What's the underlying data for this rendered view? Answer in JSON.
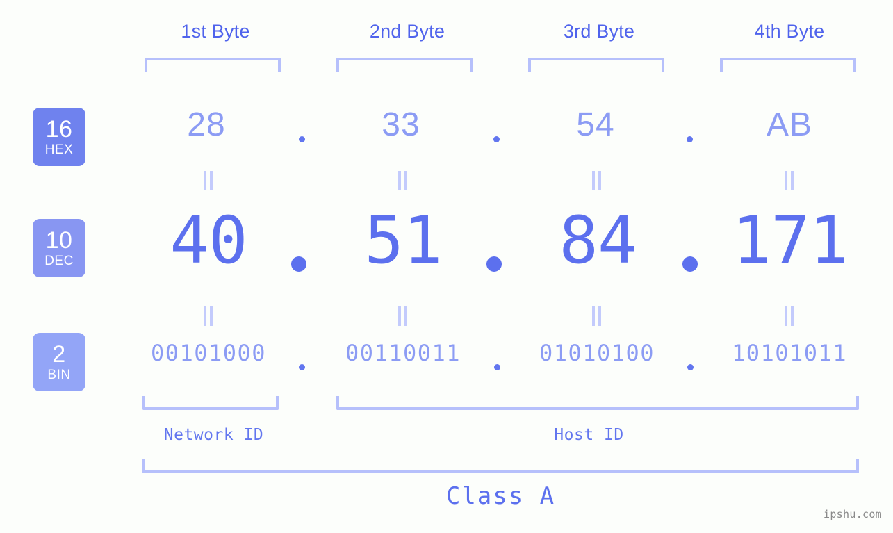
{
  "background_color": "#fcfefb",
  "accent_colors": {
    "strong_blue": "#5c70ee",
    "mid_blue": "#8c9cf4",
    "light_blue": "#b6c0fb",
    "badge_hex": "#6f82ee",
    "badge_dec": "#8896f2",
    "badge_bin": "#93a5f7",
    "watermark_gray": "#8a8a8a"
  },
  "byte_headers": [
    {
      "label": "1st Byte"
    },
    {
      "label": "2nd Byte"
    },
    {
      "label": "3rd Byte"
    },
    {
      "label": "4th Byte"
    }
  ],
  "base_badges": [
    {
      "number": "16",
      "name": "HEX"
    },
    {
      "number": "10",
      "name": "DEC"
    },
    {
      "number": "2",
      "name": "BIN"
    }
  ],
  "rows": {
    "hex": {
      "base": "16",
      "label": "HEX",
      "values": [
        "28",
        "33",
        "54",
        "AB"
      ],
      "separator": "."
    },
    "dec": {
      "base": "10",
      "label": "DEC",
      "values": [
        "40",
        "51",
        "84",
        "171"
      ],
      "separator": "."
    },
    "bin": {
      "base": "2",
      "label": "BIN",
      "values": [
        "00101000",
        "00110011",
        "01010100",
        "10101011"
      ],
      "separator": "."
    }
  },
  "equality_mark": "||",
  "sections": {
    "network_id": "Network ID",
    "host_id": "Host ID",
    "class": "Class A"
  },
  "watermark": "ipshu.com"
}
